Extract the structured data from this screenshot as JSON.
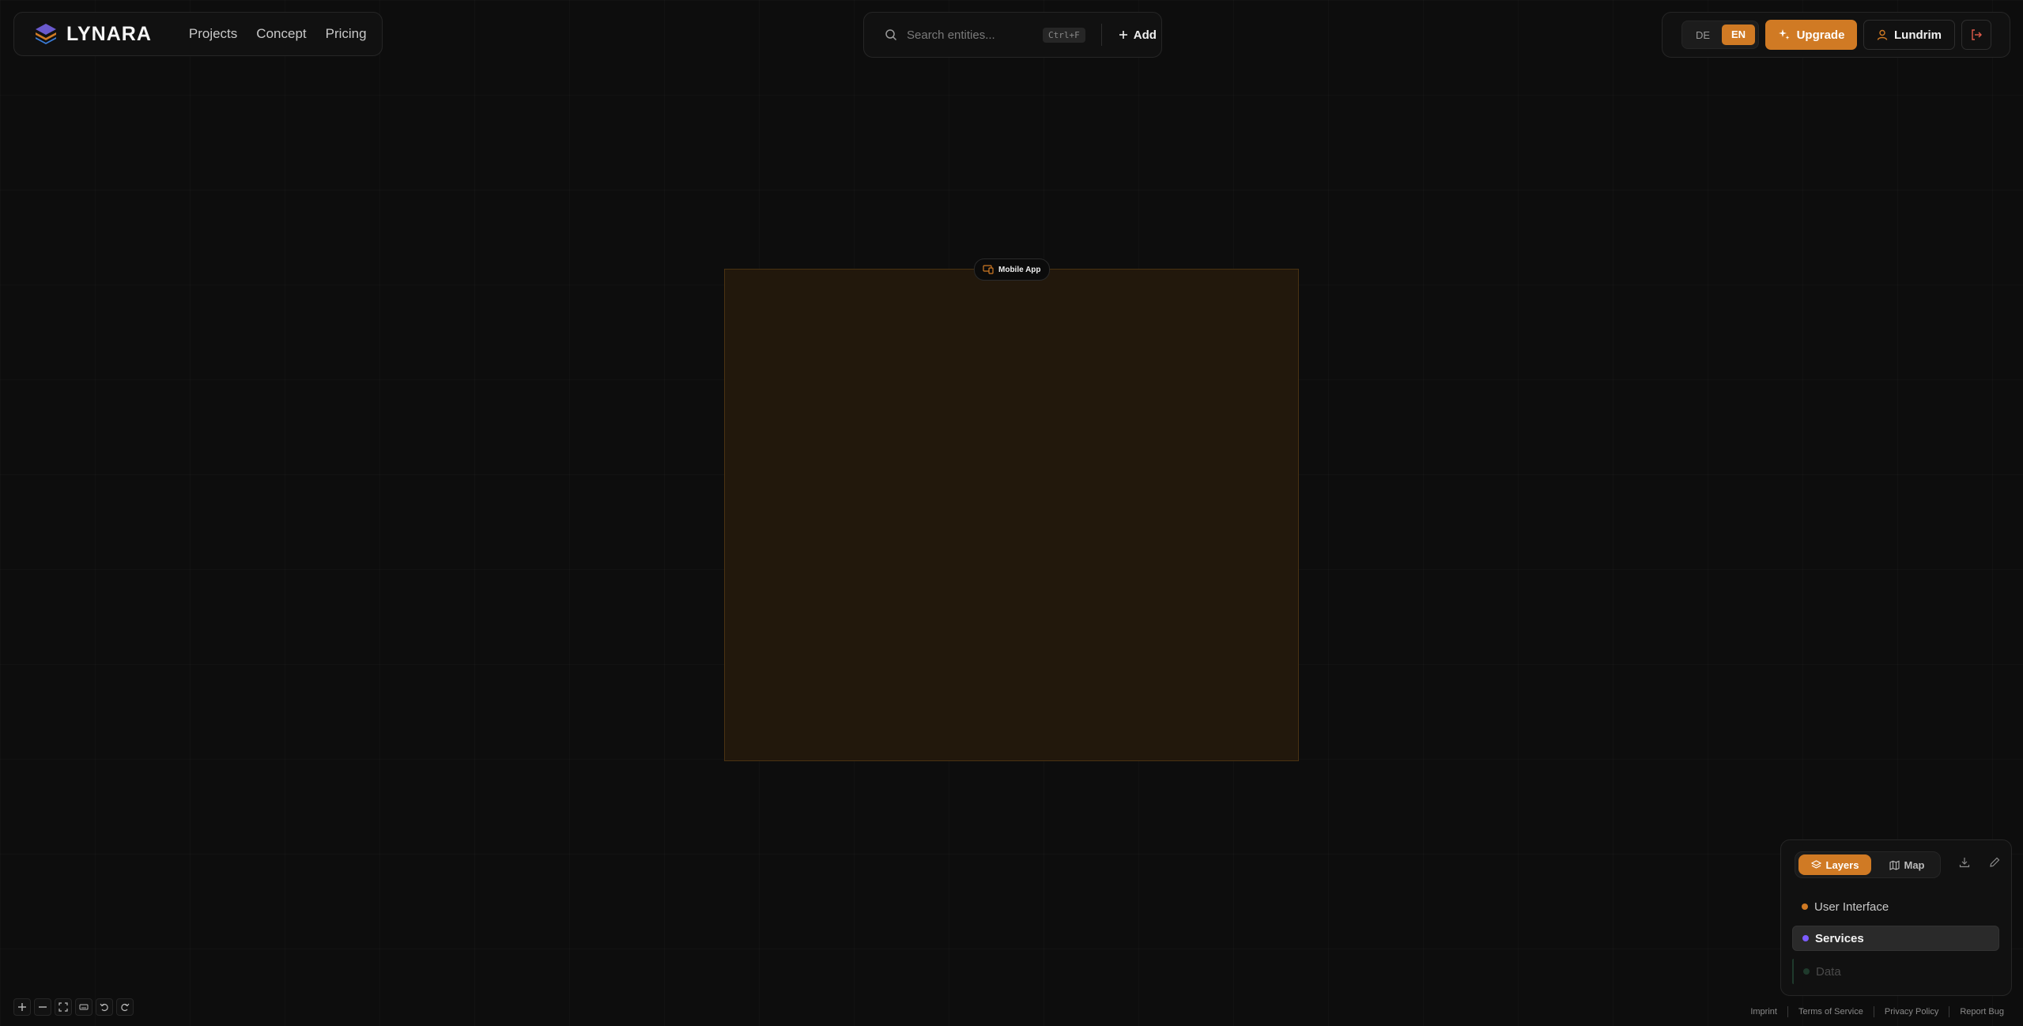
{
  "brand": {
    "name": "LYNARA"
  },
  "nav": {
    "items": [
      "Projects",
      "Concept",
      "Pricing"
    ]
  },
  "search": {
    "placeholder": "Search entities...",
    "shortcut": "Ctrl+F",
    "add_label": "Add"
  },
  "lang": {
    "de": "DE",
    "en": "EN",
    "active": "EN"
  },
  "account": {
    "upgrade_label": "Upgrade",
    "user_name": "Lundrim"
  },
  "canvas": {
    "node_label": "Mobile App",
    "node_icon": "devices-icon"
  },
  "layers_panel": {
    "tabs": [
      {
        "label": "Layers",
        "active": true
      },
      {
        "label": "Map",
        "active": false
      }
    ],
    "layers": [
      {
        "label": "User Interface",
        "color": "#d07a24",
        "state": "normal"
      },
      {
        "label": "Services",
        "color": "#7c5cff",
        "state": "active"
      },
      {
        "label": "Data",
        "color": "#2f9e6b",
        "state": "dim"
      }
    ]
  },
  "footer": {
    "links": [
      "Imprint",
      "Terms of Service",
      "Privacy Policy",
      "Report Bug"
    ]
  },
  "colors": {
    "accent": "#d07a24",
    "background": "#0d0d0d",
    "node_fill": "#22180c"
  }
}
